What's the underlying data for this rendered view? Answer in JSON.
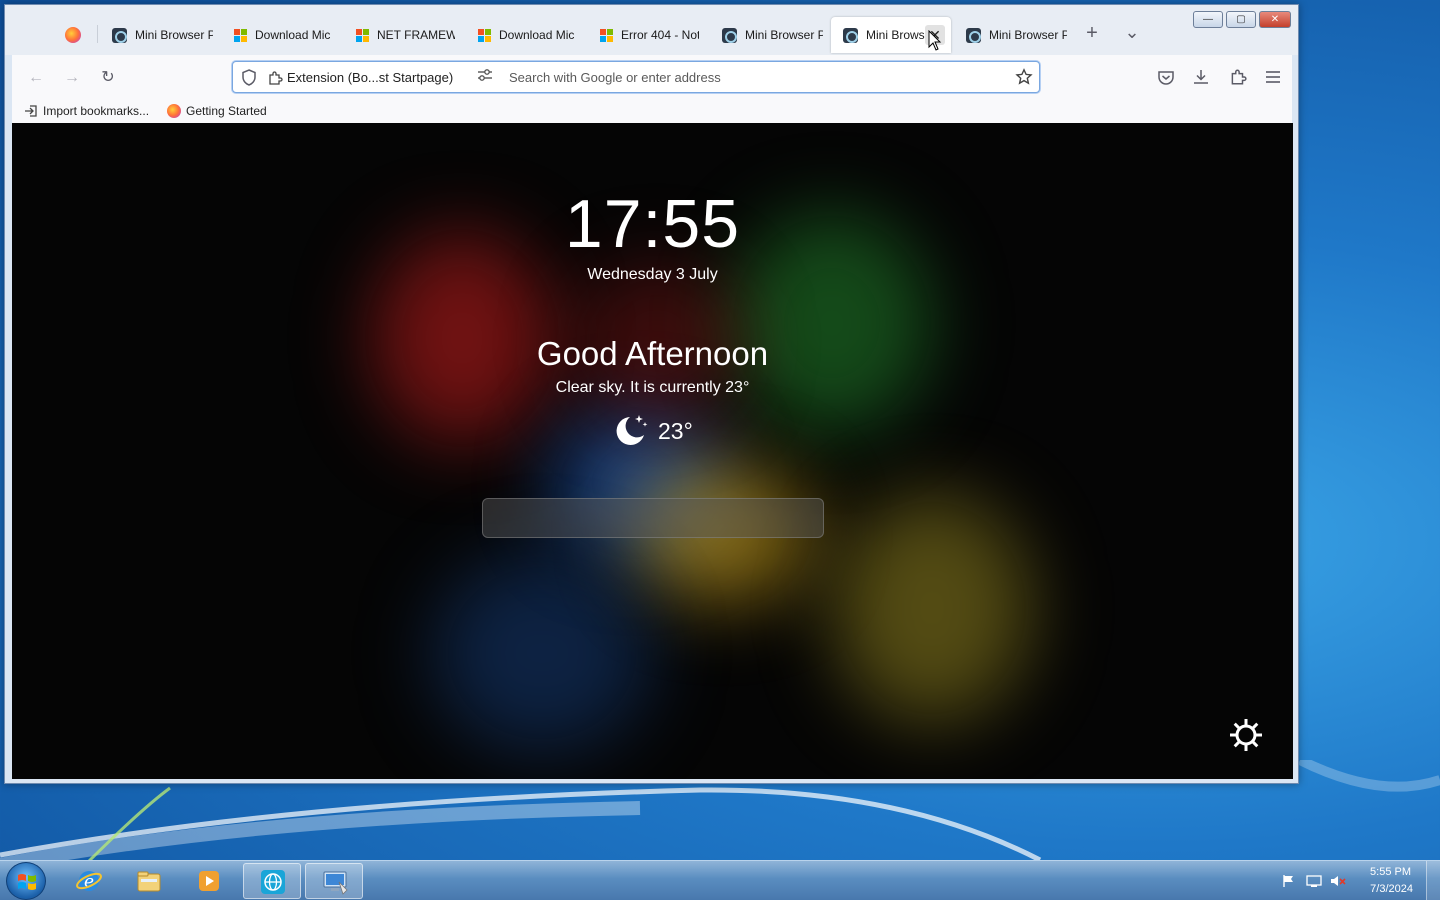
{
  "tabs": [
    {
      "label": "",
      "icon": "firefox-icon"
    },
    {
      "label": "Mini Browser P",
      "icon": "mini-browser-icon"
    },
    {
      "label": "Download Mic",
      "icon": "microsoft-icon"
    },
    {
      "label": "NET FRAMEW",
      "icon": "microsoft-icon"
    },
    {
      "label": "Download Mic",
      "icon": "microsoft-icon"
    },
    {
      "label": "Error 404 - Not",
      "icon": "microsoft-icon"
    },
    {
      "label": "Mini Browser P",
      "icon": "mini-browser-icon"
    },
    {
      "label": "Mini Brows",
      "icon": "mini-browser-icon",
      "active": true
    },
    {
      "label": "Mini Browser P",
      "icon": "mini-browser-icon"
    }
  ],
  "tab_close_glyph": "✕",
  "new_tab_glyph": "+",
  "tab_list_glyph": "⌄",
  "window_buttons": {
    "minimize": "—",
    "maximize": "▢",
    "close": "✕"
  },
  "nav": {
    "back_glyph": "←",
    "forward_glyph": "→",
    "reload_glyph": "↻"
  },
  "urlbar": {
    "extension_label": "Extension (Bo...st Startpage)",
    "placeholder": "Search with Google or enter address",
    "value": ""
  },
  "bookmarks": [
    {
      "label": "Import bookmarks...",
      "icon": "import-icon"
    },
    {
      "label": "Getting Started",
      "icon": "firefox-icon"
    }
  ],
  "startpage": {
    "time": "17:55",
    "date": "Wednesday 3 July",
    "greeting": "Good Afternoon",
    "weather_desc": "Clear sky. It is currently 23°",
    "temperature": "23°",
    "weather_icon": "moon-stars-icon"
  },
  "taskbar": {
    "items": [
      "internet-explorer",
      "file-explorer",
      "media-player",
      "mini-browser",
      "remote-desktop"
    ],
    "active_item": "mini-browser"
  },
  "tray": {
    "time": "5:55 PM",
    "date": "7/3/2024"
  },
  "colors": {
    "urlbar_focus": "#7aa7e0",
    "content_bg": "#050505",
    "taskbar": "#5a8dc0"
  }
}
